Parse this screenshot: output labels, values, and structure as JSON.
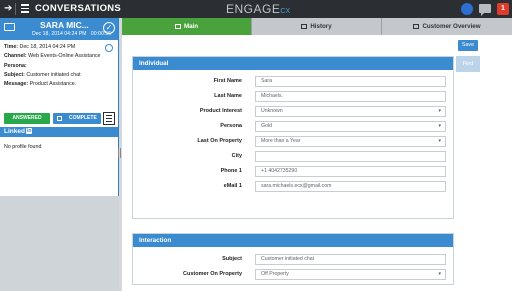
{
  "topbar": {
    "back_icon": "back-arrow-icon",
    "title": "CONVERSATIONS",
    "logo_main": "ENGAGE",
    "logo_suffix": "CX",
    "notification_count": "1"
  },
  "conversation": {
    "name": "SARA MIC...",
    "timestamp": "Dec 18, 2014 04:24 PM",
    "duration": "00:00:56",
    "details": [
      {
        "label": "Time:",
        "value": "Dec 18, 2014 04:24 PM"
      },
      {
        "label": "Channel:",
        "value": "Web Events-Online Assistance"
      },
      {
        "label": "Persona:",
        "value": ""
      },
      {
        "label": "Subject:",
        "value": "Customer initiated chat"
      },
      {
        "label": "Message:",
        "value": "Product Assistance."
      }
    ],
    "answered_label": "ANSWERED",
    "complete_label": "COMPLETE"
  },
  "linkedin": {
    "title": "Linked",
    "title_badge": "in",
    "empty_text": "No profile found"
  },
  "tabs": [
    {
      "label": "Main",
      "active": true
    },
    {
      "label": "History",
      "active": false
    },
    {
      "label": "Customer Overview",
      "active": false
    }
  ],
  "actions": {
    "save_label": "Save",
    "find_label": "Find"
  },
  "individual": {
    "title": "Individual",
    "fields": [
      {
        "label": "First Name",
        "value": "Sara",
        "type": "text"
      },
      {
        "label": "Last Name",
        "value": "Michaels.",
        "type": "text"
      },
      {
        "label": "Product Interest",
        "value": "Unknown",
        "type": "select"
      },
      {
        "label": "Persona",
        "value": "Gold",
        "type": "select"
      },
      {
        "label": "Last On Property",
        "value": "More than a Year",
        "type": "select"
      },
      {
        "label": "City",
        "value": "",
        "type": "text"
      },
      {
        "label": "Phone 1",
        "value": "+1 4042735290",
        "type": "text"
      },
      {
        "label": "eMail 1",
        "value": "sara.michaels.ecx@gmail.com",
        "type": "text"
      }
    ]
  },
  "interaction": {
    "title": "Interaction",
    "fields": [
      {
        "label": "Subject",
        "value": "Customer initiated chat",
        "type": "text"
      },
      {
        "label": "Customer On Property",
        "value": "Off Property",
        "type": "select"
      }
    ]
  },
  "colors": {
    "topbar": "#2b2f33",
    "accent_blue": "#3a8bd0",
    "tab_active": "#4aa23d",
    "answered_green": "#27a84a",
    "notification_red": "#e03b2a"
  }
}
